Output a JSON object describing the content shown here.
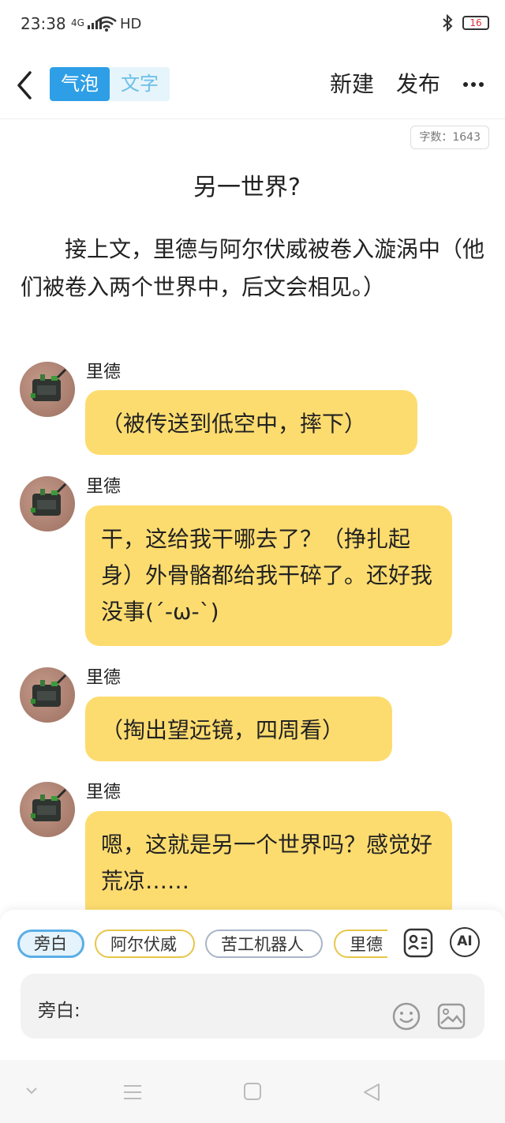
{
  "status": {
    "time": "23:38",
    "network": "4G",
    "hd": "HD",
    "battery": "16"
  },
  "header": {
    "mode_bubble": "气泡",
    "mode_text": "文字",
    "new_label": "新建",
    "publish_label": "发布"
  },
  "doc": {
    "word_count": "字数：1643",
    "title": "另一世界?",
    "narration": "接上文，里德与阿尔伏威被卷入漩涡中（他们被卷入两个世界中，后文会相见。）"
  },
  "messages": [
    {
      "speaker": "里德",
      "text": "（被传送到低空中，摔下）"
    },
    {
      "speaker": "里德",
      "text": "干，这给我干哪去了？（挣扎起身）外骨骼都给我干碎了。还好我没事(´-ω-`)"
    },
    {
      "speaker": "里德",
      "text": "（掏出望远镜，四周看）"
    },
    {
      "speaker": "里德",
      "text": "嗯，这就是另一个世界吗？感觉好荒凉……"
    }
  ],
  "composer": {
    "roles": [
      "旁白",
      "阿尔伏威",
      "苦工机器人",
      "里德"
    ],
    "ai_label": "AI",
    "input_label": "旁白:"
  },
  "colors": {
    "accent": "#2e9fe6",
    "bubble": "#fddc6f"
  }
}
